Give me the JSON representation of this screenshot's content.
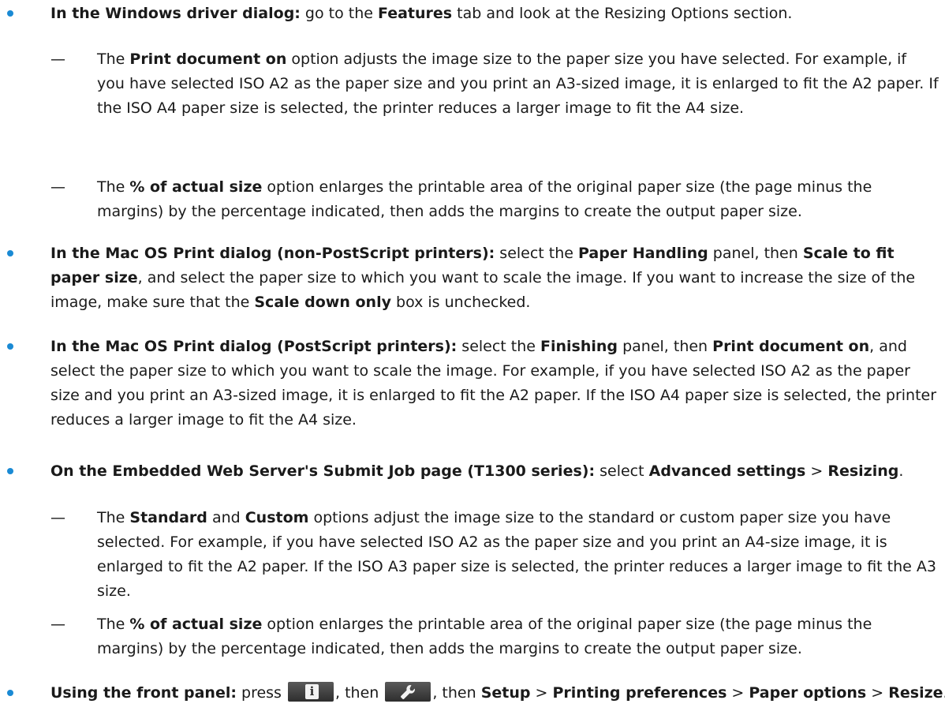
{
  "items": [
    {
      "lead": "In the Windows driver dialog:",
      "t1": " go to the ",
      "b1": "Features",
      "t2": " tab and look at the Resizing Options section.",
      "subs": [
        {
          "dash": "—",
          "t0": "The ",
          "b1": "Print document on",
          "t1": " option adjusts the image size to the paper size you have selected. For example, if you have selected ISO A2 as the paper size and you print an A3-sized image, it is enlarged to fit the A2 paper. If the ISO A4 paper size is selected, the printer reduces a larger image to fit the A4 size."
        },
        {
          "dash": "—",
          "t0": "The ",
          "b1": "% of actual size",
          "t1": " option enlarges the printable area of the original paper size (the page minus the margins) by the percentage indicated, then adds the margins to create the output paper size."
        }
      ]
    },
    {
      "lead": "In the Mac OS Print dialog (non-PostScript printers):",
      "t1": " select the ",
      "b1": "Paper Handling",
      "t2": " panel, then ",
      "b2": "Scale to fit paper size",
      "t3": ", and select the paper size to which you want to scale the image. If you want to increase the size of the image, make sure that the ",
      "b3": "Scale down only",
      "t4": " box is unchecked."
    },
    {
      "lead": "In the Mac OS Print dialog (PostScript printers):",
      "t1": " select the ",
      "b1": "Finishing",
      "t2": " panel, then ",
      "b2": "Print document on",
      "t3": ", and select the paper size to which you want to scale the image. For example, if you have selected ISO A2 as the paper size and you print an A3-sized image, it is enlarged to fit the A2 paper. If the ISO A4 paper size is selected, the printer reduces a larger image to fit the A4 size."
    },
    {
      "lead": "On the Embedded Web Server's Submit Job page (T1300 series):",
      "t1": " select ",
      "b1": "Advanced settings",
      "t2": " > ",
      "b2": "Resizing",
      "t3": ".",
      "subs": [
        {
          "dash": "—",
          "t0": "The ",
          "b1": "Standard",
          "t1": " and ",
          "b2": "Custom",
          "t2": " options adjust the image size to the standard or custom paper size you have selected. For example, if you have selected ISO A2 as the paper size and you print an A4-size image, it is enlarged to fit the A2 paper. If the ISO A3 paper size is selected, the printer reduces a larger image to fit the A3 size."
        },
        {
          "dash": "—",
          "t0": "The ",
          "b1": "% of actual size",
          "t1": " option enlarges the printable area of the original paper size (the page minus the margins) by the percentage indicated, then adds the margins to create the output paper size."
        }
      ]
    },
    {
      "lead": "Using the front panel:",
      "t1": " press ",
      "icon1": "info-icon",
      "icon1_glyph": "i",
      "t2": ", then ",
      "icon2": "wrench-icon",
      "t3": ", then ",
      "b1": "Setup",
      "t4": " > ",
      "b2": "Printing preferences",
      "t5": " > ",
      "b3": "Paper options",
      "t6": " > ",
      "b4": "Resize",
      "t7": "."
    }
  ],
  "colors": {
    "bullet": "#1a8ad4",
    "text": "#1a1a1a",
    "icon_button": "#3c3c3c"
  }
}
